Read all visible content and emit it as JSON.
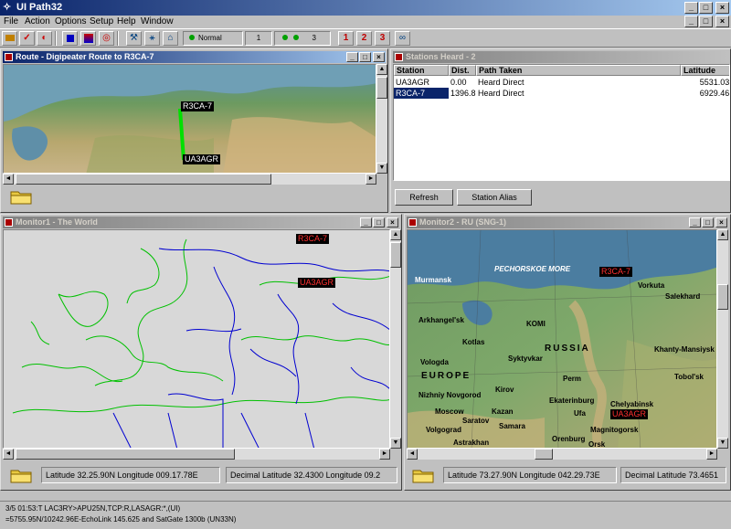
{
  "app": {
    "title": "UI Path32"
  },
  "menu": [
    "File",
    "Action",
    "Options",
    "Setup",
    "Help",
    "Window"
  ],
  "toolbar": {
    "mode_label": "Normal",
    "slot_one": "1",
    "slot_three": "3",
    "priority": [
      "1",
      "2",
      "3"
    ],
    "colors": {
      "priority": "#c00000"
    }
  },
  "route_window": {
    "title": "Route - Digipeater Route to R3CA-7",
    "labels": {
      "start": "R3CA-7",
      "end": "UA3AGR"
    }
  },
  "stations_window": {
    "title": "Stations Heard - 2",
    "columns": [
      "Station",
      "Dist.",
      "Path Taken",
      "Latitude"
    ],
    "rows": [
      {
        "station": "UA3AGR",
        "dist": "0.00",
        "path": "Heard Direct",
        "lat": "5531.03'"
      },
      {
        "station": "R3CA-7",
        "dist": "1396.8",
        "path": "Heard Direct",
        "lat": "6929.46'"
      }
    ],
    "buttons": {
      "refresh": "Refresh",
      "station_alias": "Station Alias"
    }
  },
  "monitor1": {
    "title": "Monitor1 - The World",
    "labels": {
      "a": "R3CA-7",
      "b": "UA3AGR"
    },
    "lat_lon": "Latitude 32.25.90N  Longitude 009.17.78E",
    "decimal": "Decimal Latitude 32.4300  Longitude 09.2"
  },
  "monitor2": {
    "title": "Monitor2 - RU (SNG-1)",
    "labels": {
      "a": "R3CA-7",
      "b": "UA3AGR"
    },
    "lat_lon": "Latitude 73.27.90N  Longitude 042.29.73E",
    "decimal": "Decimal Latitude 73.4651",
    "geo": {
      "russia": "RUSSIA",
      "europe": "EUROPE",
      "komi": "KOMI",
      "sea": "PECHORSKOE MORE",
      "cities": [
        "Murmansk",
        "Vorkuta",
        "Salekhard",
        "Arkhangel'sk",
        "Kotlas",
        "Syktyvkar",
        "Khanty-Mansiysk",
        "Tobol'sk",
        "Perm",
        "Ekaterinburg",
        "Kazan",
        "Samara",
        "Ufa",
        "Orenburg",
        "Magnitogorsk",
        "Chelyabinsk",
        "Nizhniy Novgorod",
        "Moscow",
        "Volgograd",
        "Astrakhan",
        "Saratov",
        "Kirov",
        "Vologda",
        "Orsk"
      ]
    }
  },
  "status": {
    "line1": "3/5 01:53:T  LAC3RY>APU25N,TCP:R,LASAGR:*,(UI)",
    "line2": "=5755.95N/10242.96E-EchoLink 145.625 and SatGate 1300b (UN33N)"
  }
}
